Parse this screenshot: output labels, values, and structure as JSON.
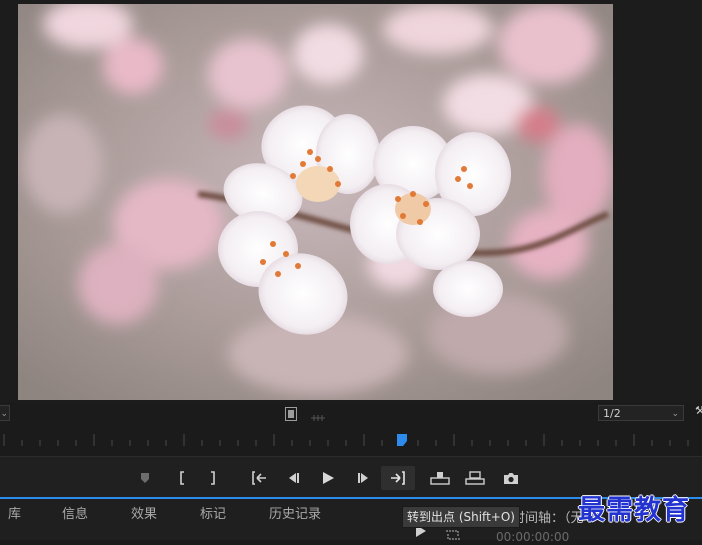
{
  "monitor": {
    "zoom_value": "",
    "resolution_value": "1/2",
    "image_description_icon": "blossom-photo"
  },
  "controls": {
    "buttons": [
      {
        "name": "add-marker-button",
        "icon": "marker-icon"
      },
      {
        "name": "mark-in-button",
        "icon": "mark-in-icon"
      },
      {
        "name": "mark-out-button",
        "icon": "mark-out-icon"
      },
      {
        "name": "go-to-in-button",
        "icon": "go-to-in-icon"
      },
      {
        "name": "step-back-button",
        "icon": "step-back-icon"
      },
      {
        "name": "play-button",
        "icon": "play-icon"
      },
      {
        "name": "step-forward-button",
        "icon": "step-forward-icon"
      },
      {
        "name": "go-to-out-button",
        "icon": "go-to-out-icon"
      },
      {
        "name": "lift-button",
        "icon": "lift-icon"
      },
      {
        "name": "extract-button",
        "icon": "extract-icon"
      },
      {
        "name": "export-frame-button",
        "icon": "camera-icon"
      }
    ]
  },
  "tooltip": "转到出点 (Shift+O)",
  "panel": {
    "tabs": [
      "库",
      "信息",
      "效果",
      "标记",
      "历史记录"
    ],
    "timeline_label": "时间轴：（无",
    "timecode": "00:00:00:00"
  },
  "watermark": "最需教育",
  "colors": {
    "accent": "#2d8ceb",
    "playhead": "#2d8ceb",
    "watermark": "#2233d0"
  }
}
